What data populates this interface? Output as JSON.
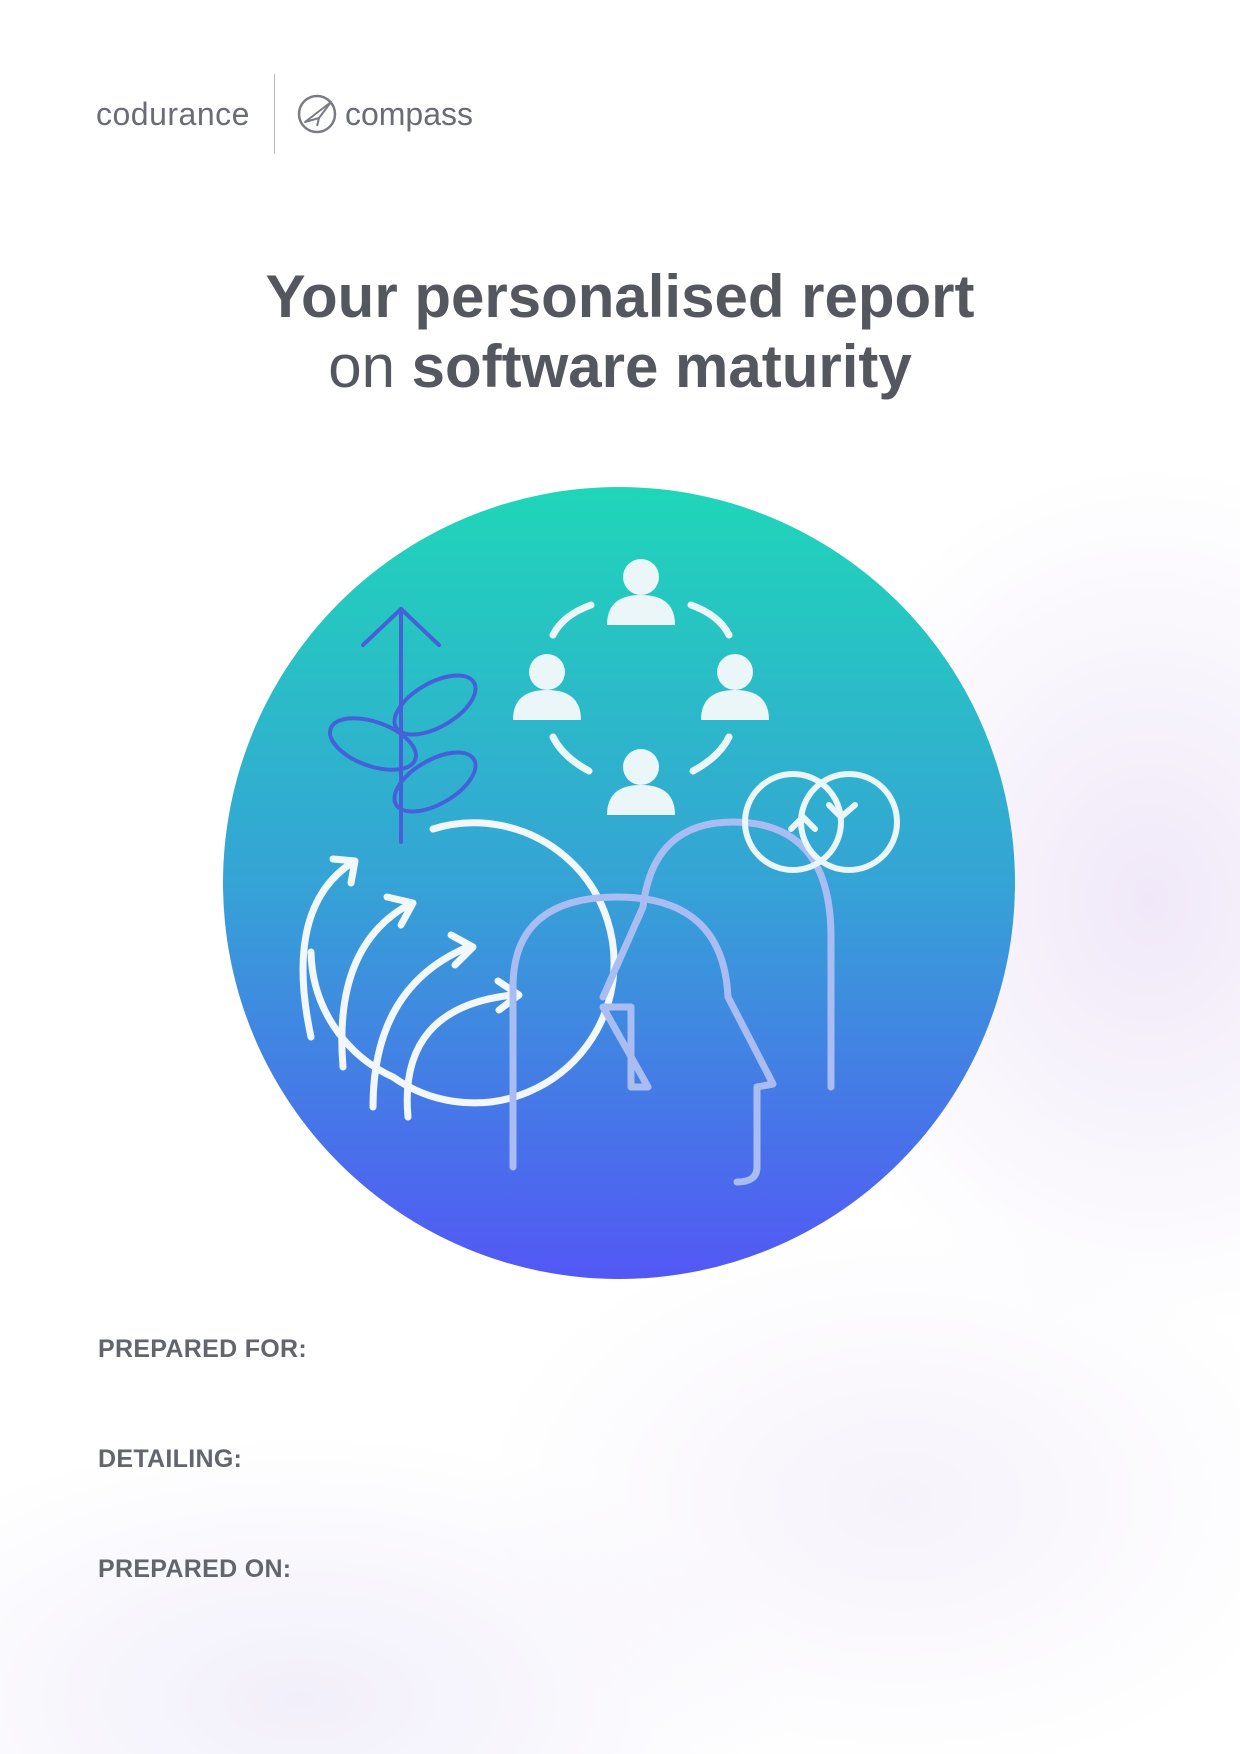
{
  "header": {
    "brand_primary": "codurance",
    "brand_secondary": "compass"
  },
  "title": {
    "line1": "Your personalised report",
    "line2_prefix": "on",
    "line2_bold": "software maturity"
  },
  "illustration": {
    "icons": [
      "growth-plant-icon",
      "team-circle-icon",
      "diverging-arrows-icon",
      "head-profile-icon",
      "cycle-icon"
    ],
    "gradient_top": "#1fd6b8",
    "gradient_bottom": "#5357f5"
  },
  "fields": [
    {
      "label": "PREPARED FOR:"
    },
    {
      "label": "DETAILING:"
    },
    {
      "label": "PREPARED ON:"
    }
  ],
  "colors": {
    "text": "#55575f",
    "label": "#63656d"
  }
}
